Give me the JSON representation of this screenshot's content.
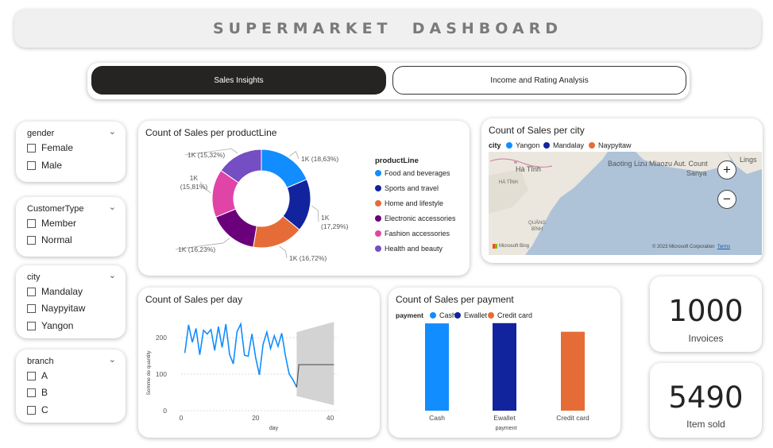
{
  "header": {
    "title": "SUPERMARKET  DASHBOARD"
  },
  "tabs": [
    {
      "label": "Sales Insights"
    },
    {
      "label": "Income and Rating Analysis"
    }
  ],
  "slicers": {
    "gender": {
      "title": "gender",
      "options": [
        "Female",
        "Male"
      ]
    },
    "customer_type": {
      "title": "CustomerType",
      "options": [
        "Member",
        "Normal"
      ]
    },
    "city": {
      "title": "city",
      "options": [
        "Mandalay",
        "Naypyitaw",
        "Yangon"
      ]
    },
    "branch": {
      "title": "branch",
      "options": [
        "A",
        "B",
        "C"
      ]
    }
  },
  "donut": {
    "title": "Count of Sales per productLine",
    "legend_title": "productLine",
    "items": [
      {
        "name": "Food and beverages",
        "label": "1K (18,63%)",
        "pct": 18.63,
        "color": "#118DFF"
      },
      {
        "name": "Sports and travel",
        "label_line1": "1K",
        "label_line2": "(17,29%)",
        "pct": 17.29,
        "color": "#12239E"
      },
      {
        "name": "Home and lifestyle",
        "label": "1K (16,72%)",
        "pct": 16.72,
        "color": "#E66C37"
      },
      {
        "name": "Electronic accessories",
        "label": "1K (16,23%)",
        "pct": 16.23,
        "color": "#6B007B"
      },
      {
        "name": "Fashion accessories",
        "label_line1": "1K",
        "label_line2": "(15,81%)",
        "pct": 15.81,
        "color": "#E044A7"
      },
      {
        "name": "Health and beauty",
        "label": "1K (15,32%)",
        "pct": 15.32,
        "color": "#744EC2"
      }
    ]
  },
  "map": {
    "title": "Count of Sales per city",
    "legend_title": "city",
    "legend": [
      {
        "name": "Yangon",
        "color": "#118DFF"
      },
      {
        "name": "Mandalay",
        "color": "#12239E"
      },
      {
        "name": "Naypyitaw",
        "color": "#E66C37"
      }
    ],
    "place_labels": [
      "Hà Tĩnh",
      "HÀ TĨNH",
      "QUẢNG BÌNH",
      "Baoting Lizu Miaozu Aut. Count",
      "Sanya",
      "Lings"
    ],
    "copyright": "© 2023 Microsoft Corporation",
    "terms": "Terms",
    "brand": "Microsoft Bing",
    "zoom_in": "+",
    "zoom_out": "−"
  },
  "line_chart": {
    "title": "Count of Sales per day"
  },
  "payment": {
    "title": "Count of Sales per payment",
    "legend_title": "payment"
  },
  "kpis": [
    {
      "value": "1000",
      "label": "Invoices"
    },
    {
      "value": "5490",
      "label": "Item sold"
    }
  ],
  "chart_data": [
    {
      "type": "line",
      "title": "Count of Sales per day",
      "xlabel": "day",
      "ylabel": "Somme de quantity",
      "xlim": [
        0,
        42
      ],
      "ylim": [
        0,
        250
      ],
      "x_ticks": [
        0,
        20,
        40
      ],
      "y_ticks": [
        0,
        100,
        200
      ],
      "series": [
        {
          "x": [
            1,
            2,
            3,
            4,
            5,
            6,
            7,
            8,
            9,
            10,
            11,
            12,
            13,
            14,
            15,
            16,
            17,
            18,
            19,
            20,
            21,
            22,
            23,
            24,
            25,
            26,
            27,
            28,
            29,
            30,
            31
          ],
          "values": [
            158,
            235,
            187,
            225,
            153,
            220,
            210,
            222,
            165,
            230,
            173,
            237,
            154,
            128,
            216,
            237,
            152,
            149,
            210,
            145,
            98,
            182,
            215,
            170,
            205,
            176,
            212,
            150,
            100,
            85,
            64
          ]
        }
      ],
      "forecast": {
        "x_start": 31,
        "x_end": 41,
        "value": 126,
        "lower_start": 40,
        "lower_end": 15,
        "upper_start": 215,
        "upper_end": 243
      },
      "grid": true
    },
    {
      "type": "bar",
      "title": "Count of Sales per payment",
      "xlabel": "payment",
      "categories": [
        "Cash",
        "Ewallet",
        "Credit card"
      ],
      "values": [
        344,
        345,
        311
      ],
      "colors": [
        "#118DFF",
        "#12239E",
        "#E66C37"
      ],
      "ylim": [
        0,
        360
      ],
      "legend": [
        "Cash",
        "Ewallet",
        "Credit card"
      ]
    },
    {
      "type": "pie",
      "title": "Count of Sales per productLine",
      "categories": [
        "Food and beverages",
        "Sports and travel",
        "Home and lifestyle",
        "Electronic accessories",
        "Fashion accessories",
        "Health and beauty"
      ],
      "values": [
        18.63,
        17.29,
        16.72,
        16.23,
        15.81,
        15.32
      ]
    }
  ]
}
